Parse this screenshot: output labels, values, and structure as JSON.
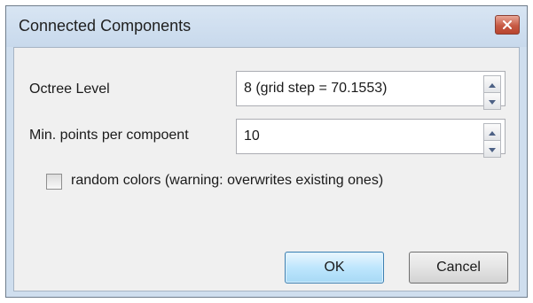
{
  "window": {
    "title": "Connected Components",
    "close_icon": "close-icon"
  },
  "fields": [
    {
      "label": "Octree Level",
      "value": "8 (grid step = 70.1553)"
    },
    {
      "label": "Min. points per compoent",
      "value": "10"
    }
  ],
  "random_colors": {
    "label": "random colors (warning: overwrites existing ones)",
    "checked": false
  },
  "buttons": {
    "ok": "OK",
    "cancel": "Cancel"
  },
  "colors": {
    "title_bar": "#cfdeee",
    "close_button": "#c75a44",
    "client_bg": "#f0f0f0",
    "default_button_border": "#3c7fb1"
  }
}
